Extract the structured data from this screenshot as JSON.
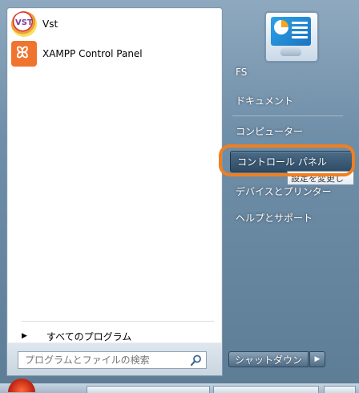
{
  "programs": [
    {
      "label": "Vst",
      "icon": "vst-icon"
    },
    {
      "label": "XAMPP Control Panel",
      "icon": "xampp-icon"
    }
  ],
  "all_programs_label": "すべてのプログラム",
  "search": {
    "placeholder": "プログラムとファイルの検索"
  },
  "right_items": [
    {
      "label": "FS"
    },
    {
      "label": "ドキュメント"
    },
    {
      "label": "コンピューター"
    },
    {
      "label": "コントロール パネル"
    },
    {
      "label": "デバイスとプリンター"
    },
    {
      "label": "ヘルプとサポート"
    }
  ],
  "tooltip": "設定を変更し",
  "shutdown_label": "シャットダウン",
  "shutdown_arrow": "▶",
  "colors": {
    "highlight": "#f07f1f",
    "xampp": "#f0742d"
  }
}
